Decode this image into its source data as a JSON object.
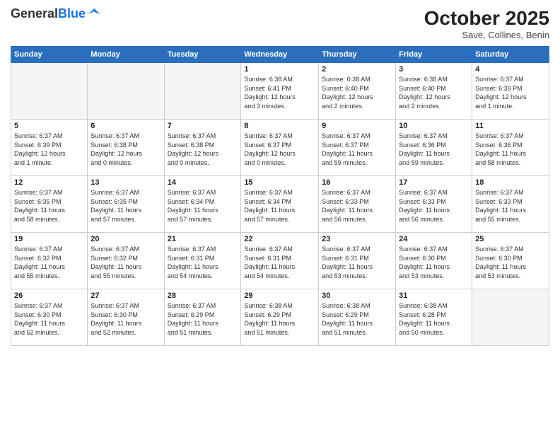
{
  "header": {
    "logo_general": "General",
    "logo_blue": "Blue",
    "month_title": "October 2025",
    "location": "Save, Collines, Benin"
  },
  "days_of_week": [
    "Sunday",
    "Monday",
    "Tuesday",
    "Wednesday",
    "Thursday",
    "Friday",
    "Saturday"
  ],
  "weeks": [
    [
      {
        "day": "",
        "info": ""
      },
      {
        "day": "",
        "info": ""
      },
      {
        "day": "",
        "info": ""
      },
      {
        "day": "1",
        "info": "Sunrise: 6:38 AM\nSunset: 6:41 PM\nDaylight: 12 hours\nand 3 minutes."
      },
      {
        "day": "2",
        "info": "Sunrise: 6:38 AM\nSunset: 6:40 PM\nDaylight: 12 hours\nand 2 minutes."
      },
      {
        "day": "3",
        "info": "Sunrise: 6:38 AM\nSunset: 6:40 PM\nDaylight: 12 hours\nand 2 minutes."
      },
      {
        "day": "4",
        "info": "Sunrise: 6:37 AM\nSunset: 6:39 PM\nDaylight: 12 hours\nand 1 minute."
      }
    ],
    [
      {
        "day": "5",
        "info": "Sunrise: 6:37 AM\nSunset: 6:39 PM\nDaylight: 12 hours\nand 1 minute."
      },
      {
        "day": "6",
        "info": "Sunrise: 6:37 AM\nSunset: 6:38 PM\nDaylight: 12 hours\nand 0 minutes."
      },
      {
        "day": "7",
        "info": "Sunrise: 6:37 AM\nSunset: 6:38 PM\nDaylight: 12 hours\nand 0 minutes."
      },
      {
        "day": "8",
        "info": "Sunrise: 6:37 AM\nSunset: 6:37 PM\nDaylight: 12 hours\nand 0 minutes."
      },
      {
        "day": "9",
        "info": "Sunrise: 6:37 AM\nSunset: 6:37 PM\nDaylight: 11 hours\nand 59 minutes."
      },
      {
        "day": "10",
        "info": "Sunrise: 6:37 AM\nSunset: 6:36 PM\nDaylight: 11 hours\nand 59 minutes."
      },
      {
        "day": "11",
        "info": "Sunrise: 6:37 AM\nSunset: 6:36 PM\nDaylight: 11 hours\nand 58 minutes."
      }
    ],
    [
      {
        "day": "12",
        "info": "Sunrise: 6:37 AM\nSunset: 6:35 PM\nDaylight: 11 hours\nand 58 minutes."
      },
      {
        "day": "13",
        "info": "Sunrise: 6:37 AM\nSunset: 6:35 PM\nDaylight: 11 hours\nand 57 minutes."
      },
      {
        "day": "14",
        "info": "Sunrise: 6:37 AM\nSunset: 6:34 PM\nDaylight: 11 hours\nand 57 minutes."
      },
      {
        "day": "15",
        "info": "Sunrise: 6:37 AM\nSunset: 6:34 PM\nDaylight: 11 hours\nand 57 minutes."
      },
      {
        "day": "16",
        "info": "Sunrise: 6:37 AM\nSunset: 6:33 PM\nDaylight: 11 hours\nand 56 minutes."
      },
      {
        "day": "17",
        "info": "Sunrise: 6:37 AM\nSunset: 6:33 PM\nDaylight: 11 hours\nand 56 minutes."
      },
      {
        "day": "18",
        "info": "Sunrise: 6:37 AM\nSunset: 6:33 PM\nDaylight: 11 hours\nand 55 minutes."
      }
    ],
    [
      {
        "day": "19",
        "info": "Sunrise: 6:37 AM\nSunset: 6:32 PM\nDaylight: 11 hours\nand 55 minutes."
      },
      {
        "day": "20",
        "info": "Sunrise: 6:37 AM\nSunset: 6:32 PM\nDaylight: 11 hours\nand 55 minutes."
      },
      {
        "day": "21",
        "info": "Sunrise: 6:37 AM\nSunset: 6:31 PM\nDaylight: 11 hours\nand 54 minutes."
      },
      {
        "day": "22",
        "info": "Sunrise: 6:37 AM\nSunset: 6:31 PM\nDaylight: 11 hours\nand 54 minutes."
      },
      {
        "day": "23",
        "info": "Sunrise: 6:37 AM\nSunset: 6:31 PM\nDaylight: 11 hours\nand 53 minutes."
      },
      {
        "day": "24",
        "info": "Sunrise: 6:37 AM\nSunset: 6:30 PM\nDaylight: 11 hours\nand 53 minutes."
      },
      {
        "day": "25",
        "info": "Sunrise: 6:37 AM\nSunset: 6:30 PM\nDaylight: 11 hours\nand 53 minutes."
      }
    ],
    [
      {
        "day": "26",
        "info": "Sunrise: 6:37 AM\nSunset: 6:30 PM\nDaylight: 11 hours\nand 52 minutes."
      },
      {
        "day": "27",
        "info": "Sunrise: 6:37 AM\nSunset: 6:30 PM\nDaylight: 11 hours\nand 52 minutes."
      },
      {
        "day": "28",
        "info": "Sunrise: 6:37 AM\nSunset: 6:29 PM\nDaylight: 11 hours\nand 51 minutes."
      },
      {
        "day": "29",
        "info": "Sunrise: 6:38 AM\nSunset: 6:29 PM\nDaylight: 11 hours\nand 51 minutes."
      },
      {
        "day": "30",
        "info": "Sunrise: 6:38 AM\nSunset: 6:29 PM\nDaylight: 11 hours\nand 51 minutes."
      },
      {
        "day": "31",
        "info": "Sunrise: 6:38 AM\nSunset: 6:28 PM\nDaylight: 11 hours\nand 50 minutes."
      },
      {
        "day": "",
        "info": ""
      }
    ]
  ]
}
